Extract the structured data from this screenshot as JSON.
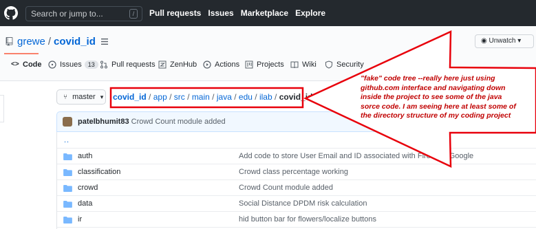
{
  "header": {
    "search_placeholder": "Search or jump to...",
    "search_key": "/",
    "nav": [
      "Pull requests",
      "Issues",
      "Marketplace",
      "Explore"
    ]
  },
  "repo": {
    "owner": "grewe",
    "separator": "/",
    "name": "covid_id",
    "unwatch_label": "Unwatch",
    "tabs": [
      {
        "label": "Code",
        "icon": "code-icon"
      },
      {
        "label": "Issues",
        "icon": "issue-icon",
        "count": "13"
      },
      {
        "label": "Pull requests",
        "icon": "pull-request-icon"
      },
      {
        "label": "ZenHub",
        "icon": "zenhub-icon"
      },
      {
        "label": "Actions",
        "icon": "play-icon"
      },
      {
        "label": "Projects",
        "icon": "project-icon"
      },
      {
        "label": "Wiki",
        "icon": "book-icon"
      },
      {
        "label": "Security",
        "icon": "shield-icon"
      }
    ]
  },
  "branch": {
    "label": "master"
  },
  "breadcrumb": {
    "parts": [
      "covid_id",
      "app",
      "src",
      "main",
      "java",
      "edu",
      "ilab"
    ],
    "current": "covid_id",
    "separator": "/"
  },
  "commit": {
    "author": "patelbhumit83",
    "message": "Crowd Count module added"
  },
  "files": {
    "up": "..",
    "rows": [
      {
        "name": "auth",
        "message": "Add code to store User Email and ID associated with Firebase Google"
      },
      {
        "name": "classification",
        "message": "Crowd class percentage working"
      },
      {
        "name": "crowd",
        "message": "Crowd Count module added"
      },
      {
        "name": "data",
        "message": "Social Distance DPDM risk calculation"
      },
      {
        "name": "ir",
        "message": "hid button bar for flowers/localize buttons"
      }
    ]
  },
  "annotation": {
    "text": "\"fake\" code tree --really here just using github.com interface and navigating down inside the project to see some of the java sorce code.   I am seeing here at least some of the directory structure of my coding project",
    "color": "#e8000b"
  }
}
